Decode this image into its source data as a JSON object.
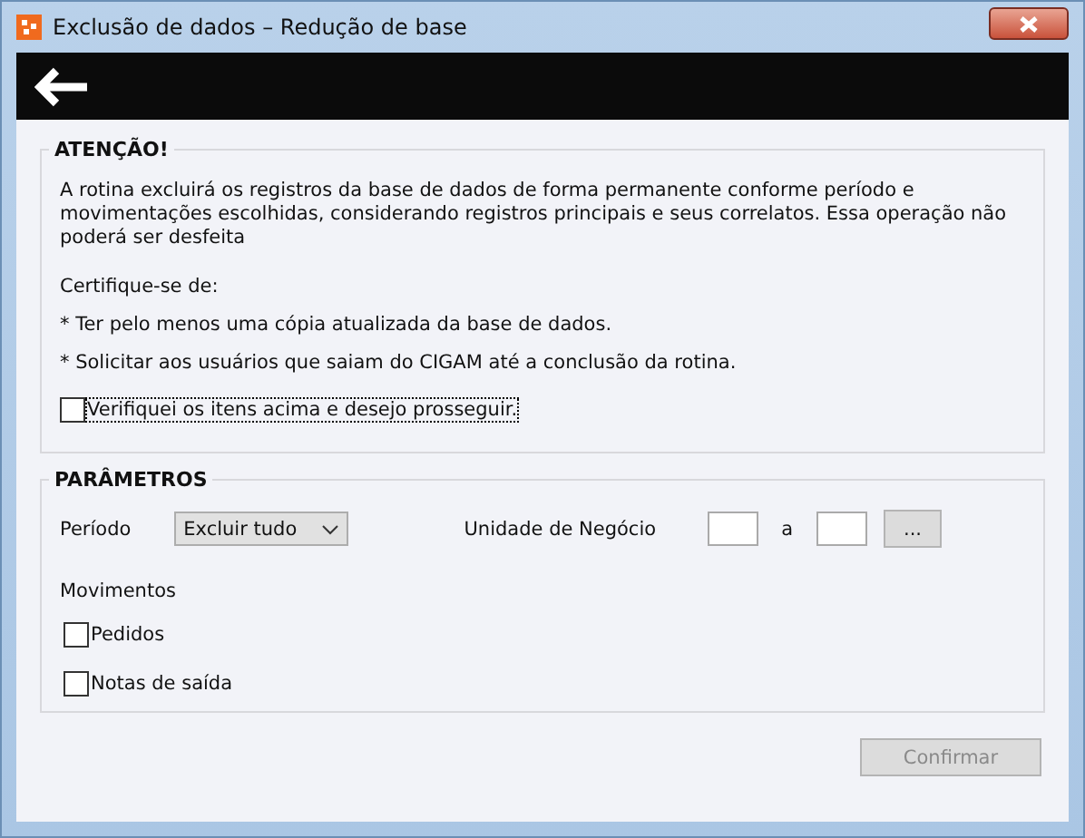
{
  "window": {
    "title": "Exclusão de dados – Redução de base"
  },
  "attention": {
    "title": "ATENÇÃO!",
    "paragraphs": [
      "A rotina excluirá os registros da base de dados de forma permanente conforme período e movimentações escolhidas, considerando registros principais e seus correlatos. Essa operação não poderá ser desfeita",
      "Certifique-se de:",
      "* Ter pelo menos uma cópia atualizada da base de dados.",
      "* Solicitar aos usuários que saiam do CIGAM até a conclusão da rotina."
    ],
    "confirm": {
      "label": "Verifiquei os itens acima e desejo prosseguir.",
      "checked": false
    }
  },
  "parameters": {
    "title": "PARÂMETROS",
    "period_label": "Período",
    "period_value": "Excluir tudo",
    "unit_label": "Unidade de Negócio",
    "range_separator": "a",
    "browse_button": "...",
    "movements_label": "Movimentos",
    "movements": [
      {
        "label": "Pedidos",
        "checked": false
      },
      {
        "label": "Notas de saída",
        "checked": false
      }
    ]
  },
  "confirm_button": {
    "label": "Confirmar",
    "disabled": true
  }
}
